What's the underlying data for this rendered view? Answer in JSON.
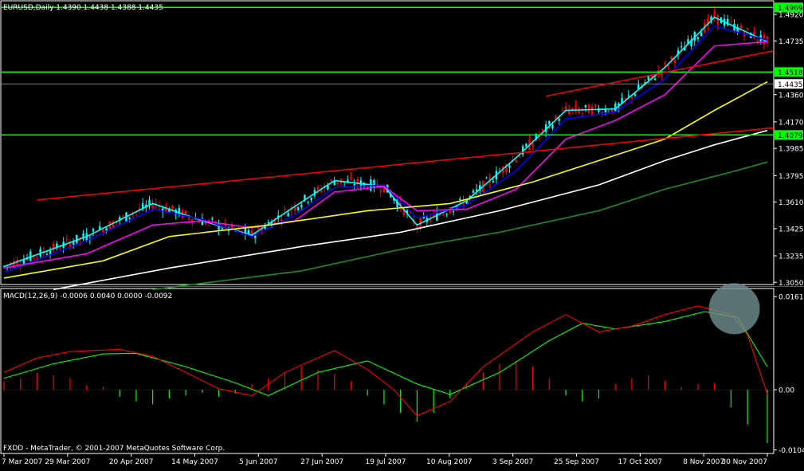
{
  "main_header": "EURUSD,Daily  1.4390 1.4438 1.4388 1.4435",
  "macd_header": "MACD(12,26,9) -0.0006 0.0040 0.0000 -0.0092",
  "copyright": "FXDD - MetaTrader, © 2001-2007 MetaQuotes Software Corp.",
  "colors": {
    "background": "#000000",
    "frame": "#ffffff",
    "bull_candle": "#00ffff",
    "bear_candle": "#ff0000",
    "hline": "#00ff00",
    "trendline": "#ff0000",
    "ma_cyan": "#00ffff",
    "ma_blue": "#0000ff",
    "ma_magenta": "#ff00ff",
    "ma_yellow": "#ffff00",
    "ma_white": "#ffffff",
    "ma_green": "#228b22",
    "macd_main": "#ff0000",
    "macd_signal": "#00ff00",
    "hist_pos": "#ff0000",
    "hist_neg": "#00ff00",
    "highlight": "#708f8f"
  },
  "chart_data": [
    {
      "type": "candlestick",
      "title": "EURUSD,Daily",
      "ohlc_last": {
        "open": 1.439,
        "high": 1.4438,
        "low": 1.4388,
        "close": 1.4435
      },
      "x_labels": [
        "7 Mar 2007",
        "29 Mar 2007",
        "20 Apr 2007",
        "14 May 2007",
        "5 Jun 2007",
        "27 Jun 2007",
        "19 Jul 2007",
        "10 Aug 2007",
        "3 Sep 2007",
        "25 Sep 2007",
        "17 Oct 2007",
        "8 Nov 2007",
        "30 Nov 2007"
      ],
      "y_ticks": [
        "1.4920",
        "1.4735",
        "1.4360",
        "1.4170",
        "1.3985",
        "1.3795",
        "1.3610",
        "1.3425",
        "1.3235",
        "1.3050"
      ],
      "ylim": [
        1.3035,
        1.5015
      ],
      "horizontal_levels": [
        {
          "value": 1.4969,
          "label": "1.4969"
        },
        {
          "value": 1.4518,
          "label": "1.4518"
        },
        {
          "value": 1.4079,
          "label": "1.4079"
        }
      ],
      "current_price": {
        "value": 1.4435,
        "label": "1.4435"
      },
      "trendlines": [
        {
          "from": [
            "7 Mar 2007",
            1.3625
          ],
          "to": [
            "30 Nov 2007",
            1.417
          ]
        },
        {
          "from": [
            "3 Sep 2007",
            1.435
          ],
          "to": [
            "30 Nov 2007",
            1.475
          ]
        }
      ],
      "moving_averages": [
        {
          "color": "ma_cyan",
          "path": [
            [
              0,
              1.316
            ],
            [
              25,
              1.337
            ],
            [
              45,
              1.36
            ],
            [
              60,
              1.348
            ],
            [
              75,
              1.338
            ],
            [
              88,
              1.358
            ],
            [
              100,
              1.376
            ],
            [
              115,
              1.372
            ],
            [
              125,
              1.345
            ],
            [
              140,
              1.362
            ],
            [
              155,
              1.392
            ],
            [
              170,
              1.425
            ],
            [
              185,
              1.426
            ],
            [
              200,
              1.455
            ],
            [
              215,
              1.49
            ],
            [
              231,
              1.473
            ]
          ]
        },
        {
          "color": "ma_blue",
          "path": [
            [
              0,
              1.312
            ],
            [
              25,
              1.334
            ],
            [
              45,
              1.356
            ],
            [
              60,
              1.349
            ],
            [
              75,
              1.337
            ],
            [
              88,
              1.352
            ],
            [
              100,
              1.371
            ],
            [
              115,
              1.373
            ],
            [
              125,
              1.35
            ],
            [
              140,
              1.359
            ],
            [
              155,
              1.383
            ],
            [
              170,
              1.419
            ],
            [
              185,
              1.424
            ],
            [
              200,
              1.447
            ],
            [
              215,
              1.484
            ],
            [
              231,
              1.474
            ]
          ]
        },
        {
          "color": "ma_magenta",
          "path": [
            [
              0,
              1.315
            ],
            [
              25,
              1.325
            ],
            [
              45,
              1.345
            ],
            [
              60,
              1.348
            ],
            [
              75,
              1.343
            ],
            [
              88,
              1.348
            ],
            [
              100,
              1.368
            ],
            [
              115,
              1.372
            ],
            [
              125,
              1.355
            ],
            [
              140,
              1.356
            ],
            [
              155,
              1.37
            ],
            [
              170,
              1.405
            ],
            [
              185,
              1.418
            ],
            [
              200,
              1.436
            ],
            [
              215,
              1.47
            ],
            [
              231,
              1.473
            ]
          ]
        },
        {
          "color": "ma_yellow",
          "path": [
            [
              0,
              1.308
            ],
            [
              30,
              1.32
            ],
            [
              50,
              1.337
            ],
            [
              80,
              1.345
            ],
            [
              110,
              1.355
            ],
            [
              135,
              1.36
            ],
            [
              160,
              1.375
            ],
            [
              180,
              1.39
            ],
            [
              200,
              1.405
            ],
            [
              215,
              1.425
            ],
            [
              231,
              1.445
            ]
          ]
        },
        {
          "color": "ma_white",
          "path": [
            [
              15,
              1.3
            ],
            [
              50,
              1.315
            ],
            [
              90,
              1.33
            ],
            [
              120,
              1.34
            ],
            [
              150,
              1.355
            ],
            [
              180,
              1.373
            ],
            [
              200,
              1.39
            ],
            [
              215,
              1.401
            ],
            [
              231,
              1.411
            ]
          ]
        },
        {
          "color": "ma_green",
          "path": [
            [
              45,
              1.3
            ],
            [
              90,
              1.313
            ],
            [
              120,
              1.328
            ],
            [
              150,
              1.34
            ],
            [
              180,
              1.355
            ],
            [
              200,
              1.37
            ],
            [
              220,
              1.382
            ],
            [
              231,
              1.389
            ]
          ]
        }
      ]
    },
    {
      "type": "macd",
      "title": "MACD(12,26,9)",
      "values": {
        "macd": -0.0006,
        "signal": 0.004,
        "third": 0.0,
        "histogram": -0.0092
      },
      "y_ticks": [
        "0.0161",
        "0.00",
        "-0.0104"
      ],
      "ylim": [
        -0.011,
        0.0175
      ],
      "main_path": [
        [
          0,
          0.003
        ],
        [
          10,
          0.0055
        ],
        [
          20,
          0.0066
        ],
        [
          35,
          0.007
        ],
        [
          45,
          0.0058
        ],
        [
          55,
          0.003
        ],
        [
          65,
          0.0002
        ],
        [
          75,
          -0.001
        ],
        [
          85,
          0.003
        ],
        [
          100,
          0.0068
        ],
        [
          110,
          0.0035
        ],
        [
          118,
          0.0
        ],
        [
          125,
          -0.0045
        ],
        [
          135,
          -0.002
        ],
        [
          145,
          0.004
        ],
        [
          160,
          0.01
        ],
        [
          170,
          0.013
        ],
        [
          180,
          0.01
        ],
        [
          190,
          0.011
        ],
        [
          200,
          0.013
        ],
        [
          210,
          0.0145
        ],
        [
          220,
          0.013
        ],
        [
          225,
          0.0095
        ],
        [
          231,
          -0.0008
        ]
      ],
      "signal_path": [
        [
          0,
          0.002
        ],
        [
          15,
          0.0045
        ],
        [
          30,
          0.0062
        ],
        [
          40,
          0.0063
        ],
        [
          55,
          0.004
        ],
        [
          70,
          0.0012
        ],
        [
          80,
          -0.001
        ],
        [
          95,
          0.003
        ],
        [
          110,
          0.005
        ],
        [
          125,
          0.001
        ],
        [
          135,
          -0.0008
        ],
        [
          150,
          0.003
        ],
        [
          165,
          0.0085
        ],
        [
          175,
          0.0115
        ],
        [
          185,
          0.0105
        ],
        [
          200,
          0.0118
        ],
        [
          212,
          0.0135
        ],
        [
          222,
          0.0125
        ],
        [
          231,
          0.004
        ]
      ],
      "histogram_bars": [
        [
          0,
          0.0015
        ],
        [
          5,
          0.002
        ],
        [
          10,
          0.003
        ],
        [
          15,
          0.0025
        ],
        [
          20,
          0.002
        ],
        [
          25,
          0.0008
        ],
        [
          30,
          0.0005
        ],
        [
          35,
          -0.0012
        ],
        [
          40,
          -0.002
        ],
        [
          45,
          -0.0025
        ],
        [
          50,
          -0.0015
        ],
        [
          55,
          -0.001
        ],
        [
          60,
          -0.0005
        ],
        [
          65,
          -0.0012
        ],
        [
          70,
          -0.0006
        ],
        [
          75,
          0.001
        ],
        [
          80,
          0.002
        ],
        [
          85,
          0.003
        ],
        [
          90,
          0.004
        ],
        [
          95,
          0.0035
        ],
        [
          100,
          0.0028
        ],
        [
          105,
          0.0015
        ],
        [
          110,
          -0.001
        ],
        [
          115,
          -0.0025
        ],
        [
          120,
          -0.004
        ],
        [
          125,
          -0.0055
        ],
        [
          130,
          -0.004
        ],
        [
          135,
          -0.0015
        ],
        [
          140,
          0.001
        ],
        [
          145,
          0.003
        ],
        [
          150,
          0.0045
        ],
        [
          155,
          0.005
        ],
        [
          160,
          0.004
        ],
        [
          165,
          0.002
        ],
        [
          170,
          -0.001
        ],
        [
          175,
          -0.002
        ],
        [
          180,
          -0.0015
        ],
        [
          185,
          0.001
        ],
        [
          190,
          0.002
        ],
        [
          195,
          0.0025
        ],
        [
          200,
          0.0015
        ],
        [
          205,
          0.0005
        ],
        [
          210,
          0.001
        ],
        [
          215,
          0.0012
        ],
        [
          220,
          -0.003
        ],
        [
          225,
          -0.006
        ],
        [
          231,
          -0.0092
        ]
      ],
      "highlight_circle": {
        "x": 221,
        "value": 0.014
      }
    }
  ]
}
